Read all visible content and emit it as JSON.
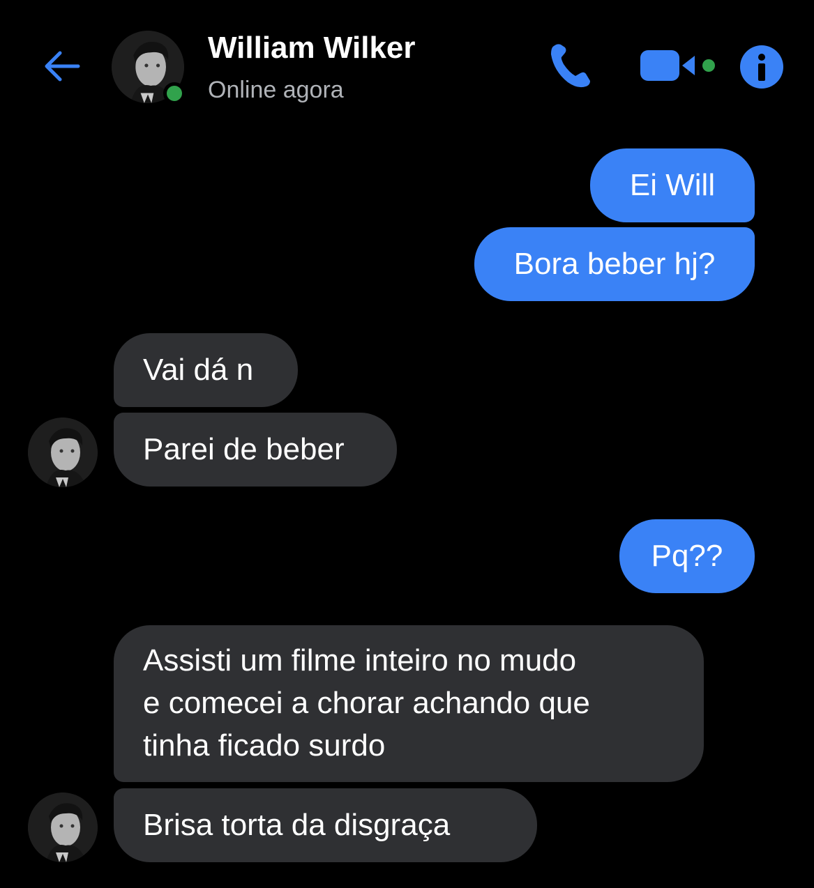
{
  "header": {
    "contact_name": "William Wilker",
    "status": "Online agora",
    "icons": {
      "back": "back-arrow-icon",
      "call": "phone-icon",
      "video": "video-camera-icon",
      "info": "info-icon"
    }
  },
  "colors": {
    "background": "#000000",
    "accent": "#3a82f6",
    "received_bubble": "#2f3033",
    "online": "#31a24c",
    "status_text": "#b0b3b8"
  },
  "messages": [
    {
      "direction": "sent",
      "text": "Ei Will"
    },
    {
      "direction": "sent",
      "text": "Bora beber hj?"
    },
    {
      "direction": "received",
      "text": "Vai dá n"
    },
    {
      "direction": "received",
      "text": "Parei de beber"
    },
    {
      "direction": "sent",
      "text": "Pq??"
    },
    {
      "direction": "received",
      "lines": [
        "Assisti um filme inteiro no mudo",
        "e comecei a chorar achando que",
        "tinha ficado surdo"
      ]
    },
    {
      "direction": "received",
      "text": "Brisa torta da disgraça"
    }
  ]
}
